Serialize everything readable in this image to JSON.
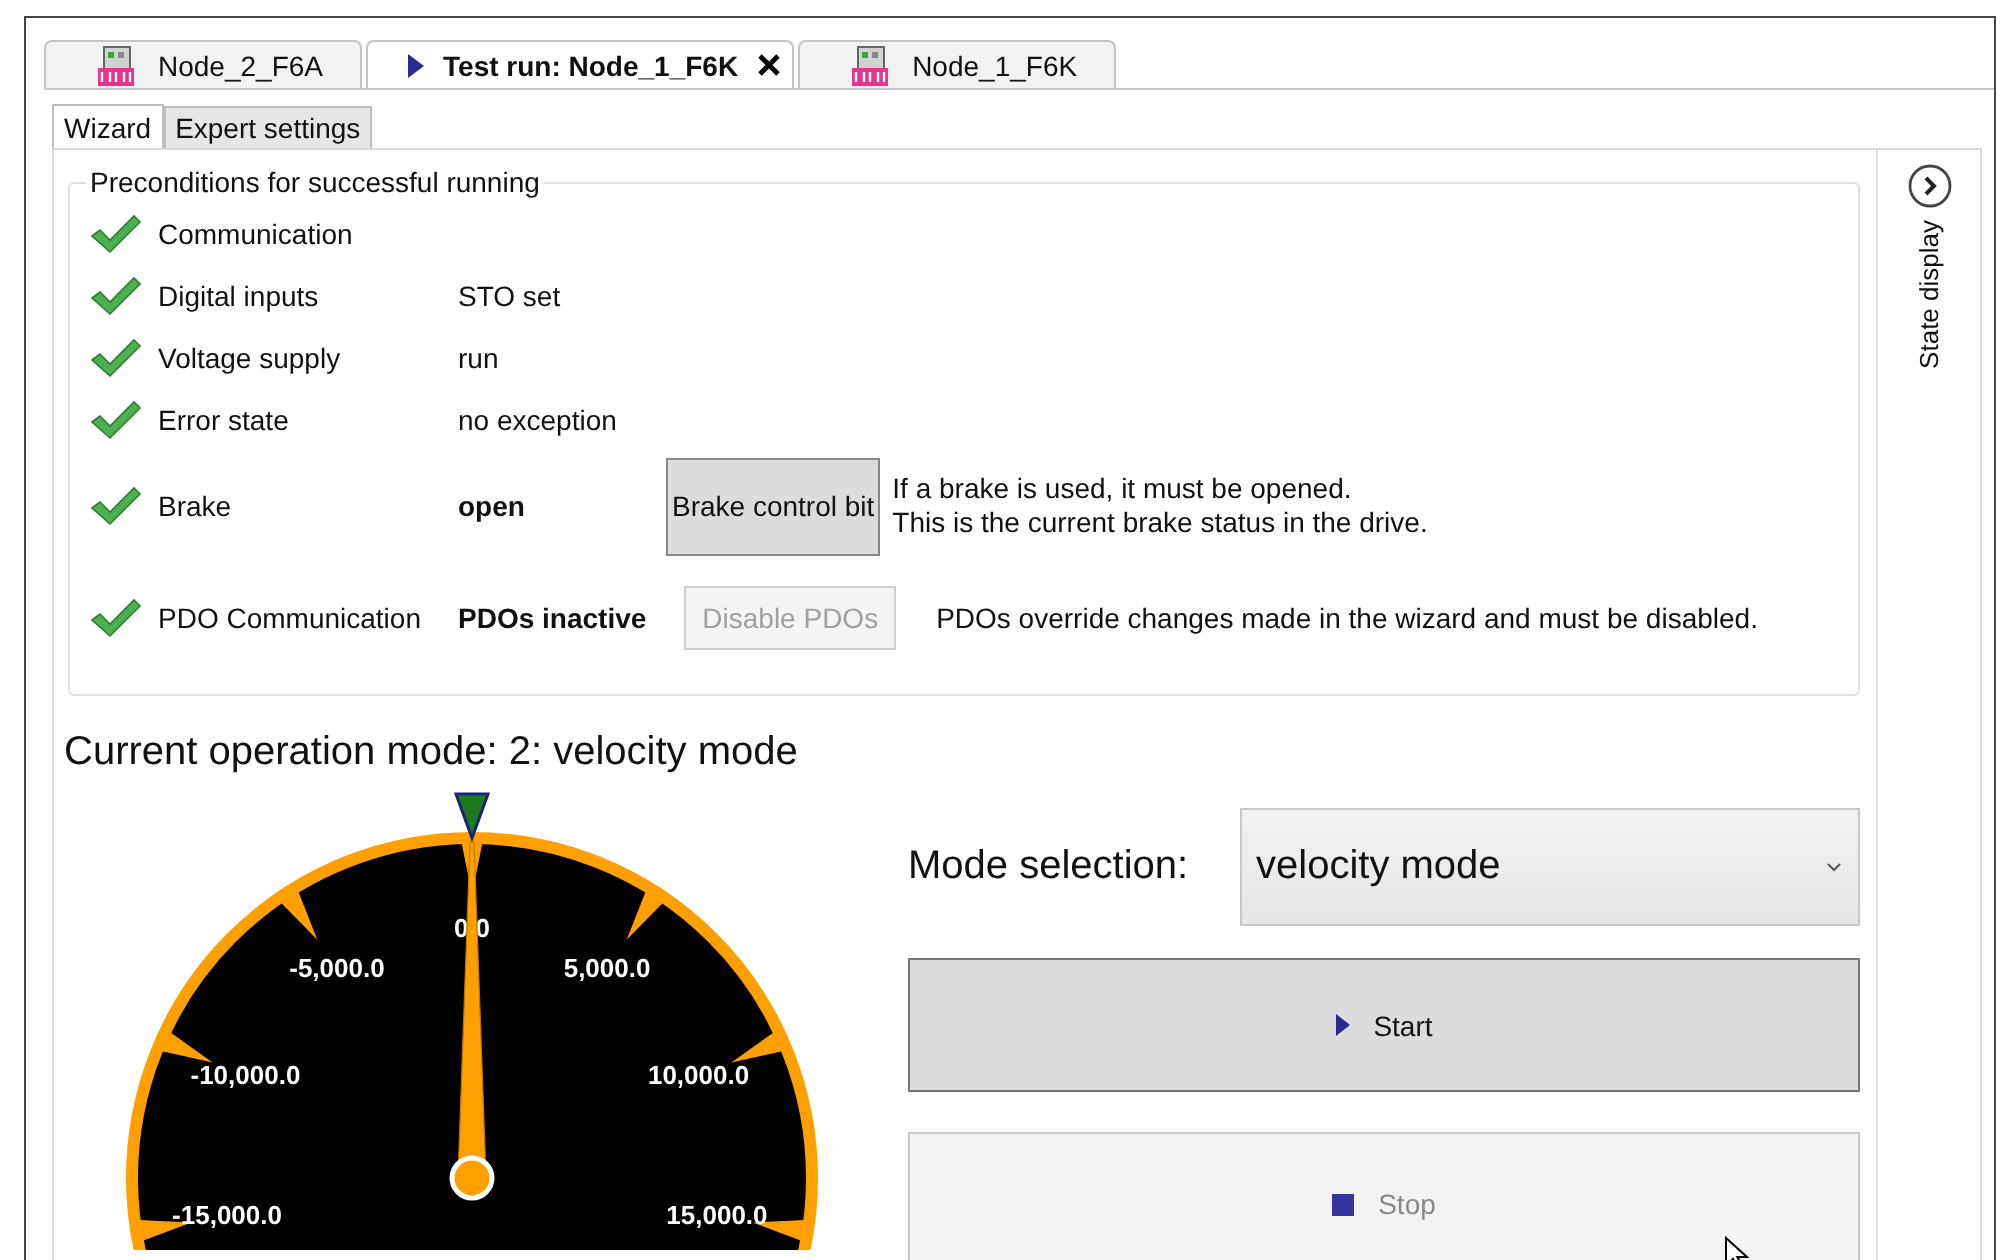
{
  "document_tabs": [
    {
      "label": "Node_2_F6A",
      "kind": "device",
      "selected": false
    },
    {
      "label": "Test run: Node_1_F6K",
      "kind": "test",
      "selected": true
    },
    {
      "label": "Node_1_F6K",
      "kind": "device",
      "selected": false
    }
  ],
  "subtabs": [
    {
      "label": "Wizard",
      "selected": true
    },
    {
      "label": "Expert settings",
      "selected": false
    }
  ],
  "preconditions": {
    "title": "Preconditions for successful running",
    "rows": [
      {
        "label": "Communication",
        "ok": true
      },
      {
        "label": "Digital inputs",
        "ok": true,
        "value": "STO set",
        "bold": false
      },
      {
        "label": "Voltage supply",
        "ok": true,
        "value": "run",
        "bold": false
      },
      {
        "label": "Error state",
        "ok": true,
        "value": "no exception",
        "bold": false
      },
      {
        "label": "Brake",
        "ok": true,
        "value": "open",
        "bold": true,
        "button": {
          "label": "Brake control bit",
          "disabled": false
        },
        "note": "If a brake is used, it must be opened.\nThis is the current brake status in the drive."
      },
      {
        "label": "PDO Communication",
        "ok": true,
        "value": "PDOs inactive",
        "bold": true,
        "button": {
          "label": "Disable PDOs",
          "disabled": true
        },
        "note": "PDOs override changes made in the wizard and must be disabled."
      }
    ]
  },
  "operation_mode": {
    "title": "Current operation mode: 2: velocity mode"
  },
  "gauge": {
    "labels": [
      "-15,000.0",
      "-10,000.0",
      "-5,000.0",
      "0.0",
      "5,000.0",
      "10,000.0",
      "15,000.0"
    ]
  },
  "mode_selection": {
    "label": "Mode selection:",
    "value": "velocity mode"
  },
  "buttons": [
    {
      "label": "Start",
      "kind": "start",
      "disabled": false
    },
    {
      "label": "Stop",
      "kind": "stop",
      "disabled": true
    }
  ],
  "side_panel": {
    "label": "State display"
  }
}
